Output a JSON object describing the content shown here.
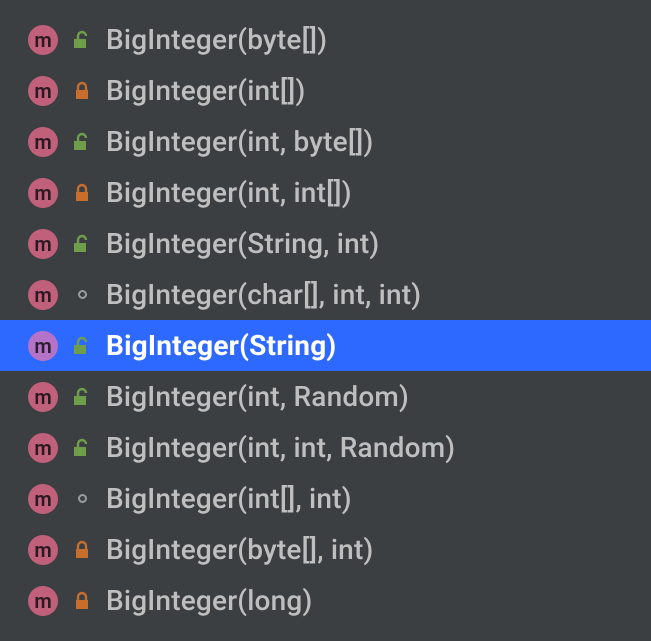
{
  "completion": {
    "items": [
      {
        "kind": "method",
        "access": "public",
        "label": "BigInteger(byte[])",
        "selected": false
      },
      {
        "kind": "method",
        "access": "private",
        "label": "BigInteger(int[])",
        "selected": false
      },
      {
        "kind": "method",
        "access": "public",
        "label": "BigInteger(int, byte[])",
        "selected": false
      },
      {
        "kind": "method",
        "access": "private",
        "label": "BigInteger(int, int[])",
        "selected": false
      },
      {
        "kind": "method",
        "access": "public",
        "label": "BigInteger(String, int)",
        "selected": false
      },
      {
        "kind": "method",
        "access": "package",
        "label": "BigInteger(char[], int, int)",
        "selected": false
      },
      {
        "kind": "method",
        "access": "public",
        "label": "BigInteger(String)",
        "selected": true
      },
      {
        "kind": "method",
        "access": "public",
        "label": "BigInteger(int, Random)",
        "selected": false
      },
      {
        "kind": "method",
        "access": "public",
        "label": "BigInteger(int, int, Random)",
        "selected": false
      },
      {
        "kind": "method",
        "access": "package",
        "label": "BigInteger(int[], int)",
        "selected": false
      },
      {
        "kind": "method",
        "access": "private",
        "label": "BigInteger(byte[], int)",
        "selected": false
      },
      {
        "kind": "method",
        "access": "private",
        "label": "BigInteger(long)",
        "selected": false
      }
    ]
  },
  "glyphs": {
    "method_letter": "m"
  }
}
